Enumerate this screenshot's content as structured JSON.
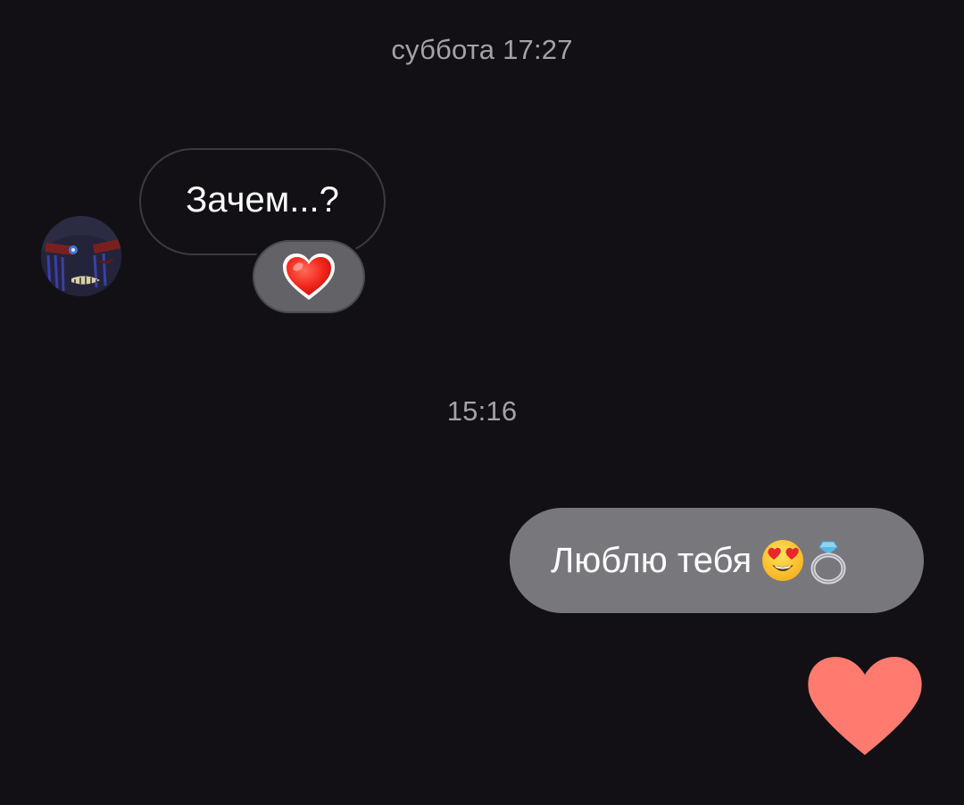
{
  "chat": {
    "timestamps": [
      "суббота 17:27",
      "15:16"
    ],
    "incoming_message": {
      "text": "Зачем...?",
      "reaction": "heart-icon",
      "reaction_color": "#ff3b30"
    },
    "outgoing_message": {
      "text": "Люблю тебя",
      "emojis": [
        "heart-eyes-emoji-icon",
        "ring-icon"
      ]
    },
    "like_button": {
      "icon": "heart-icon",
      "color": "#ff7b6f"
    }
  },
  "colors": {
    "background": "#121014",
    "incoming_border": "#3b3a3f",
    "outgoing_bubble": "#78777c",
    "timestamp": "#a3a2a7"
  }
}
